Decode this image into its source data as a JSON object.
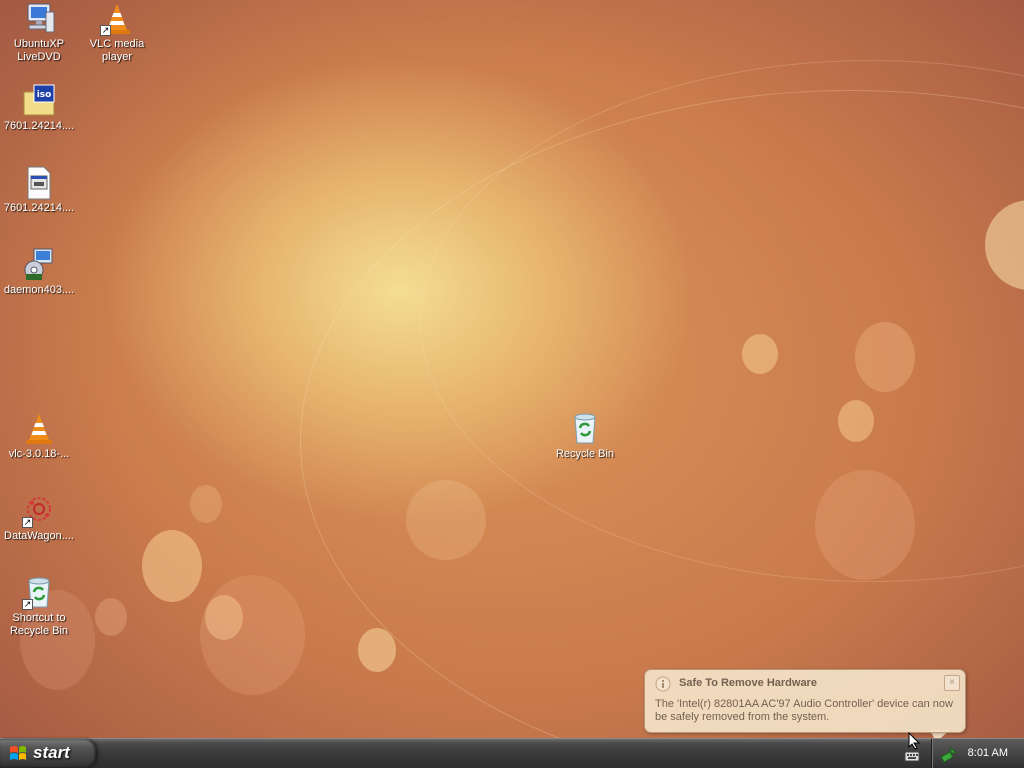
{
  "desktop": {
    "icons": [
      {
        "label": "UbuntuXP\nLiveDVD",
        "icon": "computer-icon"
      },
      {
        "label": "VLC media\nplayer",
        "icon": "vlc-cone-icon",
        "shortcut": true
      },
      {
        "label": "7601.24214....",
        "icon": "iso-file-icon"
      },
      {
        "label": "7601.24214....",
        "icon": "executable-file-icon"
      },
      {
        "label": "daemon403....",
        "icon": "installer-icon"
      },
      {
        "label": "vlc-3.0.18-...",
        "icon": "vlc-cone-icon"
      },
      {
        "label": "DataWagon....",
        "icon": "datawagon-icon",
        "shortcut": true
      },
      {
        "label": "Shortcut to\nRecycle Bin",
        "icon": "recycle-bin-icon",
        "shortcut": true
      },
      {
        "label": "Recycle Bin",
        "icon": "recycle-bin-icon"
      }
    ]
  },
  "taskbar": {
    "start_label": "start",
    "clock": "8:01 AM",
    "tray_icons": [
      "keyboard-icon",
      "safely-remove-hardware-icon"
    ]
  },
  "balloon": {
    "title": "Safe To Remove Hardware",
    "message": "The 'Intel(r) 82801AA AC'97 Audio Controller' device can now be safely removed from the system.",
    "close_label": "×"
  },
  "colors": {
    "wallpaper_center": "#f2dc98",
    "wallpaper_edge": "#864538",
    "taskbar": "#3a3a3a",
    "balloon_bg": "#f4e2c6",
    "vlc_orange": "#f08c1a"
  }
}
